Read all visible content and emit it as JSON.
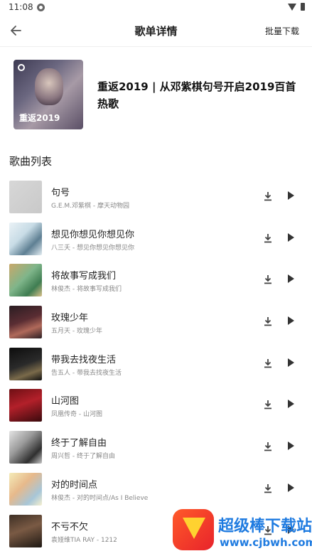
{
  "status_bar": {
    "time": "11:08"
  },
  "header": {
    "title": "歌单详情",
    "batch_download": "批量下载"
  },
  "playlist": {
    "cover_text": "重返2019",
    "title": "重返2019 | 从邓紫棋句号开启2019百首热歌"
  },
  "section": {
    "title": "歌曲列表"
  },
  "songs": [
    {
      "title": "句号",
      "subtitle": "G.E.M.邓紫棋 - 摩天动物园",
      "thumb": "linear-gradient(135deg,#d7d7d7,#c9c9c9)"
    },
    {
      "title": "想见你想见你想见你",
      "subtitle": "八三夭 - 想见你想见你想见你",
      "thumb": "linear-gradient(135deg,#eaf2f6 0%,#c8dce6 40%,#5e7f93 70%,#e3edf2 100%)"
    },
    {
      "title": "将故事写成我们",
      "subtitle": "林俊杰 - 将故事写成我们",
      "thumb": "linear-gradient(135deg,#c9a86a 0%,#7fb58a 45%,#3f7d52 75%,#d9c08a 100%)"
    },
    {
      "title": "玫瑰少年",
      "subtitle": "五月天 - 玫瑰少年",
      "thumb": "linear-gradient(160deg,#2a1d22 0%,#5a2d33 45%,#b0695a 70%,#2c1f24 100%)"
    },
    {
      "title": "带我去找夜生活",
      "subtitle": "告五人 - 带我去找夜生活",
      "thumb": "linear-gradient(160deg,#0d0d0d 0%,#2a2a2a 50%,#7a6a4a 75%,#111 100%)"
    },
    {
      "title": "山河图",
      "subtitle": "凤凰传奇 - 山河图",
      "thumb": "linear-gradient(160deg,#6e0f14 0%,#b3202a 45%,#3a0a0d 100%)"
    },
    {
      "title": "终于了解自由",
      "subtitle": "周兴哲 - 终于了解自由",
      "thumb": "linear-gradient(135deg,#e4e4e4 0%,#9a9a9a 40%,#2f2f2f 75%,#c8c8c8 100%)"
    },
    {
      "title": "对的时间点",
      "subtitle": "林俊杰 - 对的时间点/As I Believe",
      "thumb": "linear-gradient(135deg,#f4ebb8 0%,#e7b98b 40%,#a7c6d8 75%,#f6f0d0 100%)"
    },
    {
      "title": "不亏不欠",
      "subtitle": "袁娅维TIA RAY - 1212",
      "thumb": "linear-gradient(160deg,#3d2f24 0%,#7a5a44 45%,#1e1813 100%)"
    }
  ],
  "watermark": {
    "title": "超级棒下载站",
    "url": "www.cjbwh.com"
  }
}
